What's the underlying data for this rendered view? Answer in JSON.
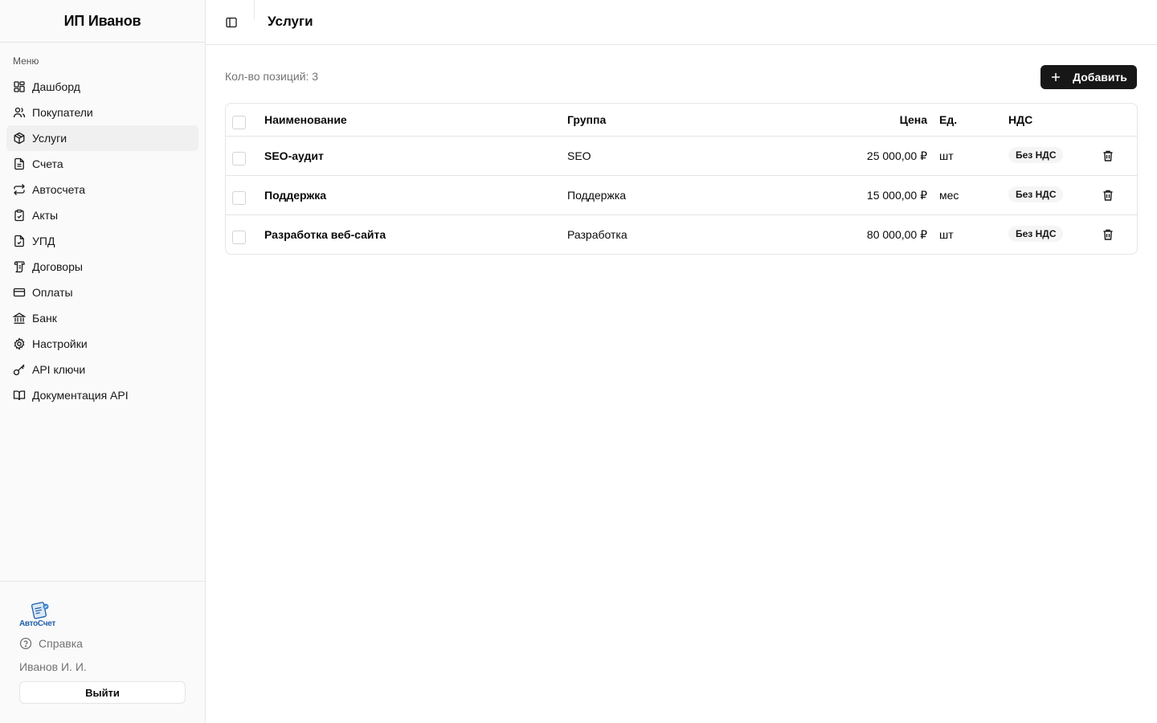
{
  "sidebar": {
    "company": "ИП Иванов",
    "group_label": "Меню",
    "items": [
      {
        "label": "Дашборд",
        "icon": "dashboard-icon",
        "active": false
      },
      {
        "label": "Покупатели",
        "icon": "users-icon",
        "active": false
      },
      {
        "label": "Услуги",
        "icon": "package-icon",
        "active": true
      },
      {
        "label": "Счета",
        "icon": "file-text-icon",
        "active": false
      },
      {
        "label": "Автосчета",
        "icon": "repeat-icon",
        "active": false
      },
      {
        "label": "Акты",
        "icon": "clipboard-icon",
        "active": false
      },
      {
        "label": "УПД",
        "icon": "file-icon",
        "active": false
      },
      {
        "label": "Договоры",
        "icon": "scroll-icon",
        "active": false
      },
      {
        "label": "Оплаты",
        "icon": "credit-card-icon",
        "active": false
      },
      {
        "label": "Банк",
        "icon": "bank-icon",
        "active": false
      },
      {
        "label": "Настройки",
        "icon": "gear-icon",
        "active": false
      },
      {
        "label": "API ключи",
        "icon": "key-icon",
        "active": false
      },
      {
        "label": "Документация API",
        "icon": "book-icon",
        "active": false
      }
    ],
    "footer": {
      "logo_text": "АвтоСчет",
      "help_label": "Справка",
      "user_name": "Иванов И. И.",
      "logout_label": "Выйти"
    }
  },
  "header": {
    "title": "Услуги"
  },
  "main": {
    "count_label": "Кол-во позиций: 3",
    "add_label": "Добавить",
    "table": {
      "columns": {
        "name": "Наименование",
        "group": "Группа",
        "price": "Цена",
        "unit": "Ед.",
        "vat": "НДС"
      },
      "rows": [
        {
          "name": "SEO-аудит",
          "group": "SEO",
          "price": "25 000,00 ₽",
          "unit": "шт",
          "vat": "Без НДС"
        },
        {
          "name": "Поддержка",
          "group": "Поддержка",
          "price": "15 000,00 ₽",
          "unit": "мес",
          "vat": "Без НДС"
        },
        {
          "name": "Разработка веб-сайта",
          "group": "Разработка",
          "price": "80 000,00 ₽",
          "unit": "шт",
          "vat": "Без НДС"
        }
      ]
    }
  },
  "colors": {
    "primary": "#171717",
    "sidebar_bg": "#fafafa",
    "border": "#e5e5e5",
    "muted_text": "#737373",
    "brand_blue": "#1f5fa8"
  }
}
